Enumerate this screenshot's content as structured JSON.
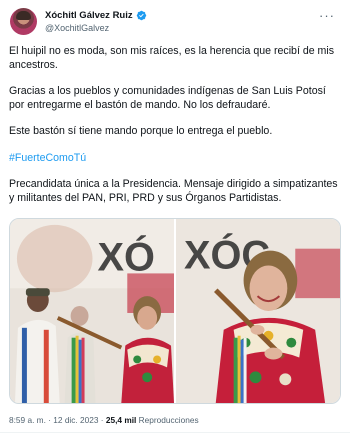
{
  "author": {
    "display_name": "Xóchitl Gálvez Ruiz",
    "handle": "@XochitlGalvez",
    "verified": true,
    "verified_color": "#1d9bf0",
    "avatar_icon": "profile-photo"
  },
  "more_icon": "more-horizontal-icon",
  "tweet": {
    "paragraphs": [
      "El huipil no es moda, son mis raíces, es la herencia que recibí de mis ancestros.",
      "Gracias a los pueblos y comunidades indígenas de San Luis Potosí por entregarme el bastón de mando. No los defraudaré.",
      "Este bastón sí tiene mando porque lo entrega el pueblo."
    ],
    "hashtag": "#FuerteComoTú",
    "closing": "Precandidata única a la Presidencia. Mensaje dirigido a simpatizantes y militantes del PAN, PRI, PRD y sus Órganos Partidistas."
  },
  "media": {
    "photos": [
      {
        "backdrop_text": "XÓ"
      },
      {
        "backdrop_text": "XÓC"
      }
    ]
  },
  "meta": {
    "time": "8:59 a. m.",
    "separator": " · ",
    "date": "12 dic. 2023",
    "views_count": "25,4 mil",
    "views_label": " Reproducciones"
  },
  "colors": {
    "text": "#0f1419",
    "secondary": "#536471",
    "link": "#1d9bf0"
  }
}
